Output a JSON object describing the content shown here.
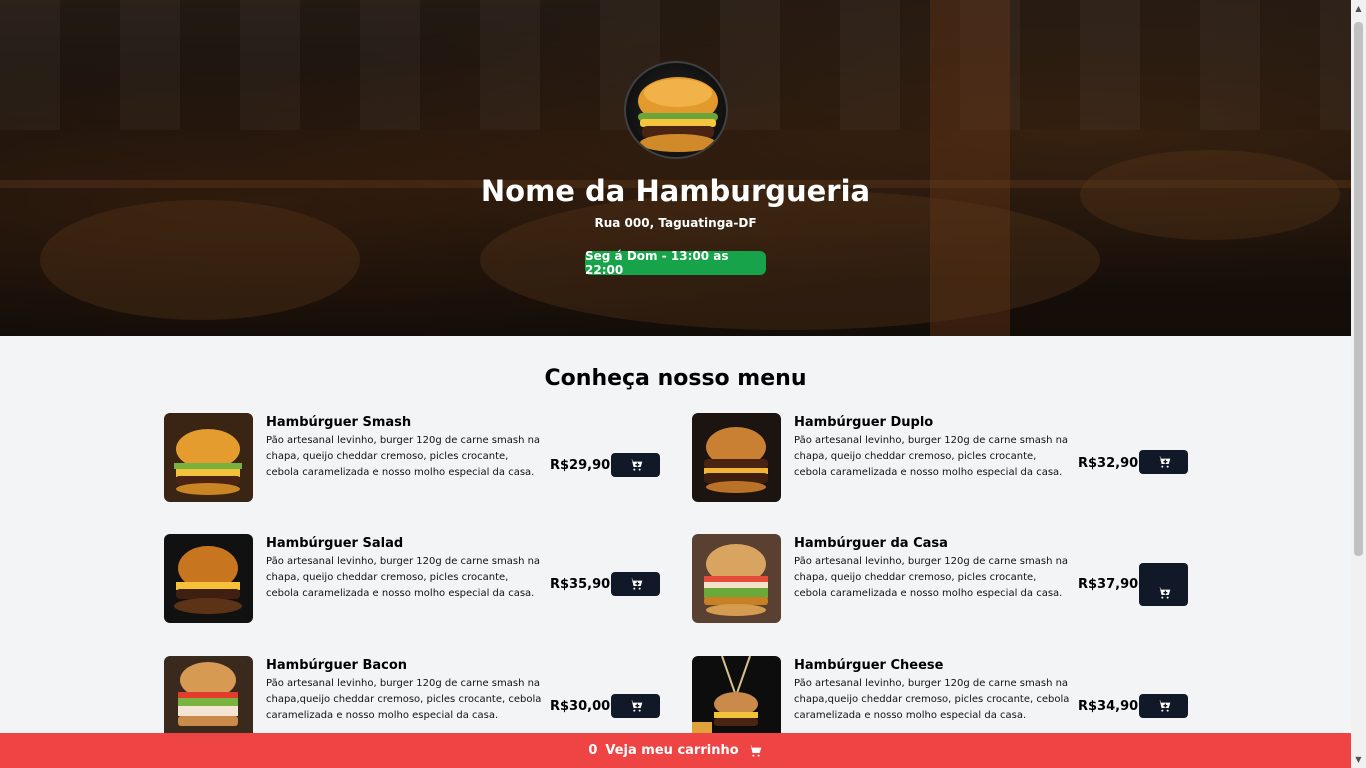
{
  "hero": {
    "title": "Nome da Hamburgueria",
    "address": "Rua 000, Taguatinga-DF",
    "hours": "Seg á Dom - 13:00 as 22:00"
  },
  "menu": {
    "title": "Conheça nosso menu",
    "items": [
      {
        "name": "Hambúrguer Smash",
        "description": "Pão artesanal levinho, burger 120g de carne smash na chapa, queijo cheddar cremoso, picles crocante, cebola caramelizada e nosso molho especial da casa.",
        "price": "R$29,90"
      },
      {
        "name": "Hambúrguer Duplo",
        "description": "Pão artesanal levinho, burger 120g de carne smash na chapa, queijo cheddar cremoso, picles crocante, cebola caramelizada e nosso molho especial da casa.",
        "price": "R$32,90"
      },
      {
        "name": "Hambúrguer Salad",
        "description": "Pão artesanal levinho, burger 120g de carne smash na chapa, queijo cheddar cremoso, picles crocante, cebola caramelizada e nosso molho especial da casa.",
        "price": "R$35,90"
      },
      {
        "name": "Hambúrguer da Casa",
        "description": "Pão artesanal levinho, burger 120g de carne smash na chapa, queijo cheddar cremoso, picles crocante, cebola caramelizada e nosso molho especial da casa.",
        "price": "R$37,90"
      },
      {
        "name": "Hambúrguer Bacon",
        "description": "Pão artesanal levinho, burger 120g de carne smash na chapa,queijo cheddar cremoso, picles crocante, cebola caramelizada e nosso molho especial da casa.",
        "price": "R$30,00"
      },
      {
        "name": "Hambúrguer Cheese",
        "description": "Pão artesanal levinho, burger 120g de carne smash na chapa,queijo cheddar cremoso, picles crocante, cebola caramelizada e nosso molho especial da casa.",
        "price": "R$34,90"
      }
    ],
    "add_icon": "cart-plus-icon"
  },
  "cart_bar": {
    "count": "0",
    "label": "Veja meu carrinho",
    "icon": "cart-icon"
  },
  "colors": {
    "hours_badge": "#16a34a",
    "cart_button": "#111827",
    "cart_bar": "#ef4444",
    "page_bg": "#f3f4f6"
  }
}
